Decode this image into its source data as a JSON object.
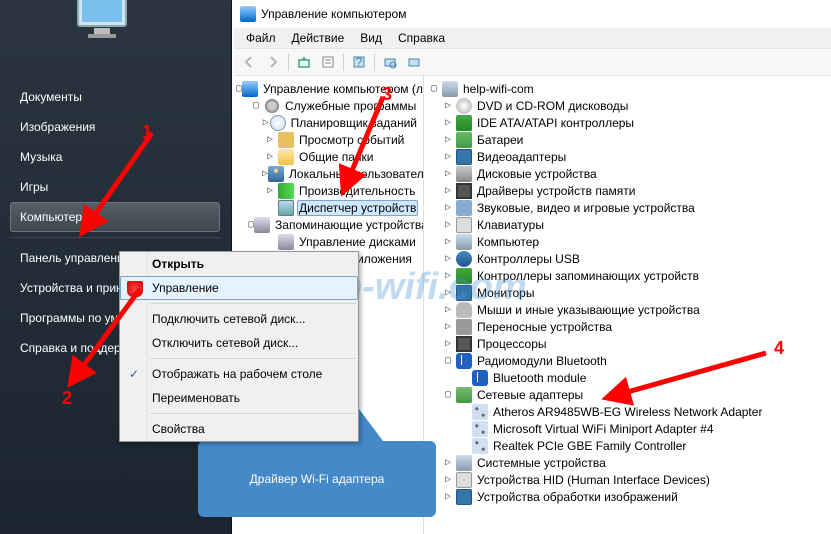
{
  "window_title": "Управление компьютером",
  "menubar": [
    "Файл",
    "Действие",
    "Вид",
    "Справка"
  ],
  "start_menu": {
    "documents": "Документы",
    "images": "Изображения",
    "music": "Музыка",
    "games": "Игры",
    "computer": "Компьютер",
    "control_panel": "Панель управления",
    "devices": "Устройства и принтеры",
    "programs": "Программы по умолчанию",
    "help": "Справка и поддержка"
  },
  "context_menu": {
    "open": "Открыть",
    "manage": "Управление",
    "map_drive": "Подключить сетевой диск...",
    "unmap_drive": "Отключить сетевой диск...",
    "show_desktop": "Отображать на рабочем столе",
    "rename": "Переименовать",
    "properties": "Свойства"
  },
  "left_tree": {
    "root": "Управление компьютером (локальным)",
    "sys_tools": "Служебные программы",
    "task_scheduler": "Планировщик заданий",
    "event_viewer": "Просмотр событий",
    "shared": "Общие папки",
    "local_users": "Локальные пользователи",
    "performance": "Производительность",
    "device_manager": "Диспетчер устройств",
    "storage": "Запоминающие устройства",
    "disk_mgmt": "Управление дисками",
    "services": "Службы и приложения"
  },
  "right_tree": {
    "host": "help-wifi-com",
    "dvd": "DVD и CD-ROM дисководы",
    "ide": "IDE ATA/ATAPI контроллеры",
    "battery": "Батареи",
    "video": "Видеоадаптеры",
    "disk": "Дисковые устройства",
    "mem": "Драйверы устройств памяти",
    "audio": "Звуковые, видео и игровые устройства",
    "kb": "Клавиатуры",
    "computer": "Компьютер",
    "usb": "Контроллеры USB",
    "storage_ctrl": "Контроллеры запоминающих устройств",
    "monitors": "Мониторы",
    "mice": "Мыши и иные указывающие устройства",
    "portable": "Переносные устройства",
    "cpu": "Процессоры",
    "bt_radio": "Радиомодули Bluetooth",
    "bt_module": "Bluetooth module",
    "net_adapters": "Сетевые адаптеры",
    "atheros": "Atheros AR9485WB-EG Wireless Network Adapter",
    "ms_virtual": "Microsoft Virtual WiFi Miniport Adapter #4",
    "realtek": "Realtek PCIe GBE Family Controller",
    "system": "Системные устройства",
    "hid": "Устройства HID (Human Interface Devices)",
    "imaging": "Устройства обработки изображений"
  },
  "callout": "Драйвер Wi-Fi адаптера",
  "annotations": {
    "n1": "1",
    "n2": "2",
    "n3": "3",
    "n4": "4"
  },
  "watermark": "help-wifi.com"
}
